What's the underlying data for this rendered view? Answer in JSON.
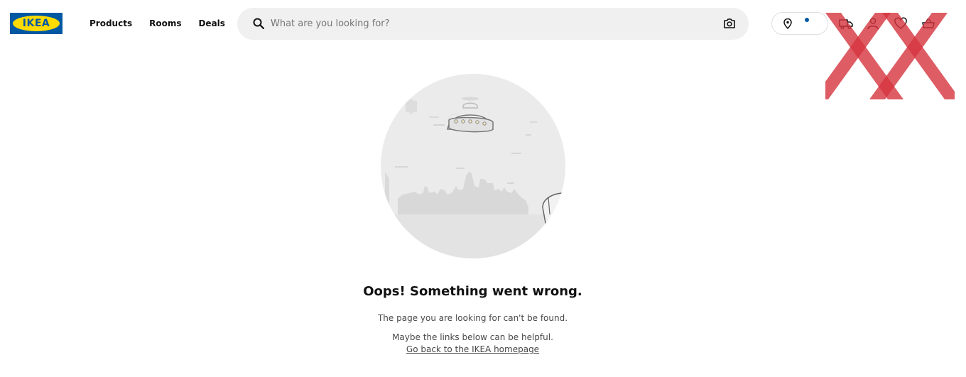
{
  "header": {
    "logo_text": "IKEA",
    "nav": [
      {
        "label": "Products"
      },
      {
        "label": "Rooms"
      },
      {
        "label": "Deals"
      }
    ],
    "search": {
      "placeholder": "What are you looking for?",
      "icon": "search-icon",
      "camera_icon": "camera-icon"
    },
    "location": {
      "icon": "pin-icon",
      "indicator_color": "#0058a3"
    },
    "icons": [
      "delivery-truck-icon",
      "account-icon",
      "heart-icon",
      "cart-icon"
    ]
  },
  "colors": {
    "brand_blue": "#0058a3",
    "brand_yellow": "#ffdb00",
    "overlay_red": "#d6343f",
    "illustration_gray": "#e6e6e6"
  },
  "error": {
    "title": "Oops! Something went wrong.",
    "message": "The page you are looking for can't be found.",
    "helper": "Maybe the links below can be helpful.",
    "home_link": "Go back to the IKEA homepage"
  }
}
